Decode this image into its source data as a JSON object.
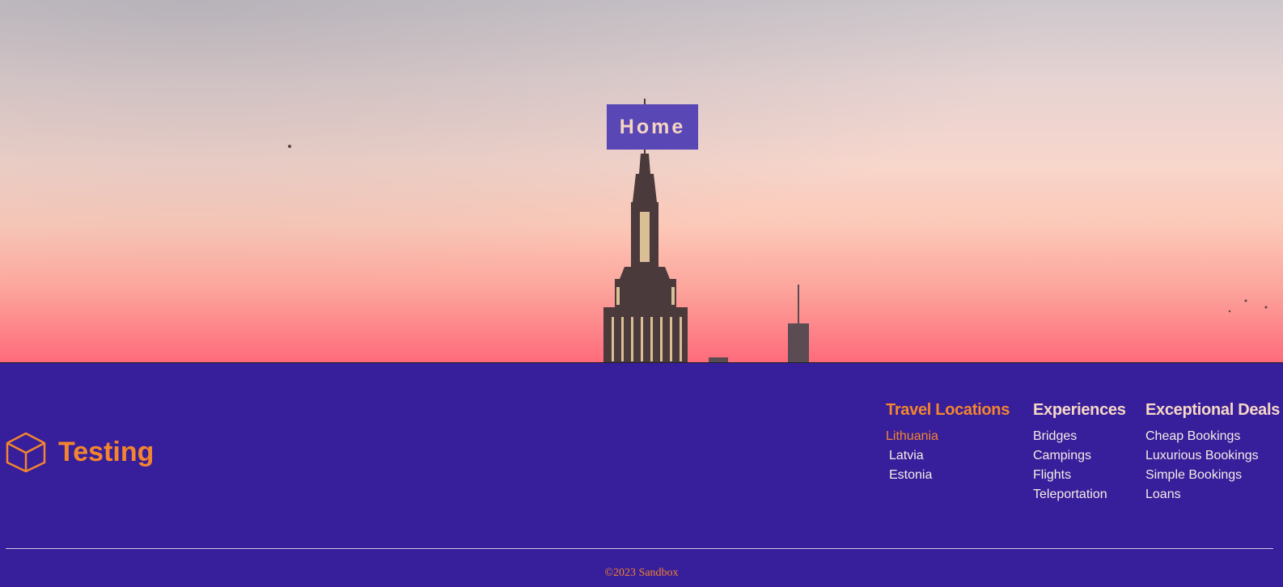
{
  "hero": {
    "badge_label": "Home"
  },
  "footer": {
    "brand": {
      "name": "Testing",
      "icon": "cube-icon",
      "color": "#f4852e"
    },
    "columns": [
      {
        "title": "Travel Locations",
        "items": [
          "Lithuania",
          "Latvia",
          "Estonia"
        ]
      },
      {
        "title": "Experiences",
        "items": [
          "Bridges",
          "Campings",
          "Flights",
          "Teleportation"
        ]
      },
      {
        "title": "Exceptional Deals",
        "items": [
          "Cheap Bookings",
          "Luxurious Bookings",
          "Simple Bookings",
          "Loans"
        ]
      }
    ],
    "copyright": "©2023 Sandbox"
  },
  "colors": {
    "footer_background": "#371e9a",
    "accent": "#f4852e",
    "badge_background": "#5947b5"
  }
}
